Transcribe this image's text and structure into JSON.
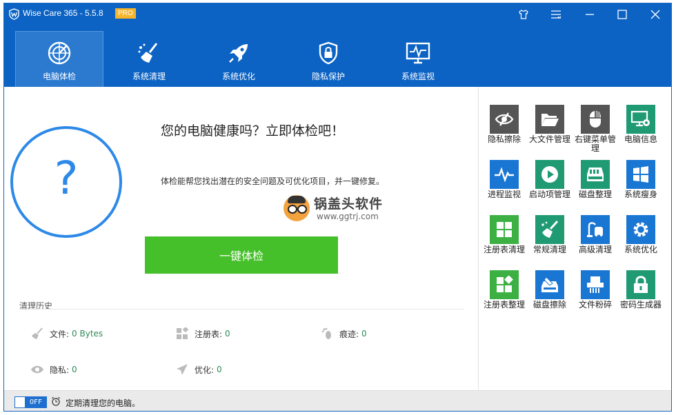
{
  "app": {
    "title": "Wise Care 365 - 5.5.8",
    "badge": "PRO"
  },
  "titlebar_buttons": [
    "shirt-icon",
    "menu-icon",
    "minimize-icon",
    "maximize-icon",
    "close-icon"
  ],
  "nav": [
    {
      "label": "电脑体检",
      "icon": "radar-icon",
      "active": true
    },
    {
      "label": "系统清理",
      "icon": "broom-icon",
      "active": false
    },
    {
      "label": "系统优化",
      "icon": "rocket-icon",
      "active": false
    },
    {
      "label": "隐私保护",
      "icon": "lock-shield-icon",
      "active": false
    },
    {
      "label": "系统监视",
      "icon": "monitor-icon",
      "active": false
    }
  ],
  "main": {
    "headline": "您的电脑健康吗？立即体检吧！",
    "description": "体检能帮您找出潜在的安全问题及可优化项目，并一键修复。",
    "status_symbol": "?",
    "check_button": "一键体检",
    "watermark": {
      "title": "锅盖头软件",
      "url": "www.ggtrj.com"
    }
  },
  "history": {
    "title": "清理历史",
    "items": [
      {
        "label": "文件:",
        "value": "0 Bytes",
        "icon": "broom-icon"
      },
      {
        "label": "注册表:",
        "value": "0",
        "icon": "registry-icon"
      },
      {
        "label": "痕迹:",
        "value": "0",
        "icon": "footprint-icon"
      },
      {
        "label": "隐私:",
        "value": "0",
        "icon": "eye-icon"
      },
      {
        "label": "优化:",
        "value": "0",
        "icon": "plane-icon"
      }
    ]
  },
  "tools": [
    {
      "label": "隐私擦除",
      "icon": "eye-slash-icon",
      "color": "#555555"
    },
    {
      "label": "大文件管理",
      "icon": "folder-icon",
      "color": "#555555"
    },
    {
      "label": "右键菜单管理",
      "icon": "mouse-icon",
      "color": "#555555"
    },
    {
      "label": "电脑信息",
      "icon": "pc-info-icon",
      "color": "#1f9a73"
    },
    {
      "label": "进程监视",
      "icon": "pulse-icon",
      "color": "#1976d2"
    },
    {
      "label": "启动项管理",
      "icon": "play-icon",
      "color": "#1f9a73"
    },
    {
      "label": "磁盘整理",
      "icon": "disk-icon",
      "color": "#1f9a73"
    },
    {
      "label": "系统瘦身",
      "icon": "windows-icon",
      "color": "#1976d2"
    },
    {
      "label": "注册表清理",
      "icon": "grid-icon",
      "color": "#3cb043"
    },
    {
      "label": "常规清理",
      "icon": "brush-icon",
      "color": "#1f9a73"
    },
    {
      "label": "高级清理",
      "icon": "vacuum-icon",
      "color": "#1976d2"
    },
    {
      "label": "系统优化",
      "icon": "gear-icon",
      "color": "#1976d2"
    },
    {
      "label": "注册表整理",
      "icon": "grid-diamond-icon",
      "color": "#3cb043"
    },
    {
      "label": "磁盘擦除",
      "icon": "disk-erase-icon",
      "color": "#1976d2"
    },
    {
      "label": "文件粉碎",
      "icon": "shredder-icon",
      "color": "#1976d2"
    },
    {
      "label": "密码生成器",
      "icon": "padlock-icon",
      "color": "#1f9a73"
    }
  ],
  "footer": {
    "toggle": "OFF",
    "text": "定期清理您的电脑。"
  }
}
